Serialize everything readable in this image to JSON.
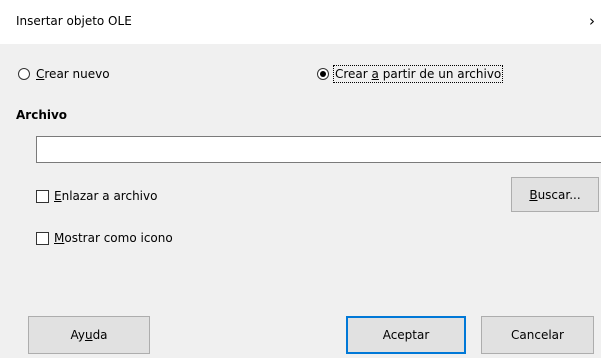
{
  "window": {
    "title": "Insertar objeto OLE",
    "close_glyph": "›"
  },
  "mode": {
    "create_new": {
      "pre": "",
      "key": "C",
      "post": "rear nuevo",
      "checked": false
    },
    "from_file": {
      "pre": "Crear ",
      "key": "a",
      "post": " partir de un archivo",
      "checked": true
    }
  },
  "file_section": {
    "label": "Archivo",
    "path_value": ""
  },
  "options": {
    "link_to_file": {
      "key": "E",
      "post": "nlazar a archivo",
      "checked": false
    },
    "show_as_icon": {
      "key": "M",
      "post": "ostrar como icono",
      "checked": false
    }
  },
  "buttons": {
    "browse": {
      "key": "B",
      "post": "uscar..."
    },
    "help": {
      "pre": "Ay",
      "key": "u",
      "post": "da"
    },
    "ok": {
      "label": "Aceptar"
    },
    "cancel": {
      "label": "Cancelar"
    }
  },
  "colors": {
    "default_button_border": "#0078d7",
    "dialog_background": "#f0f0f0",
    "titlebar_background": "#ffffff"
  }
}
